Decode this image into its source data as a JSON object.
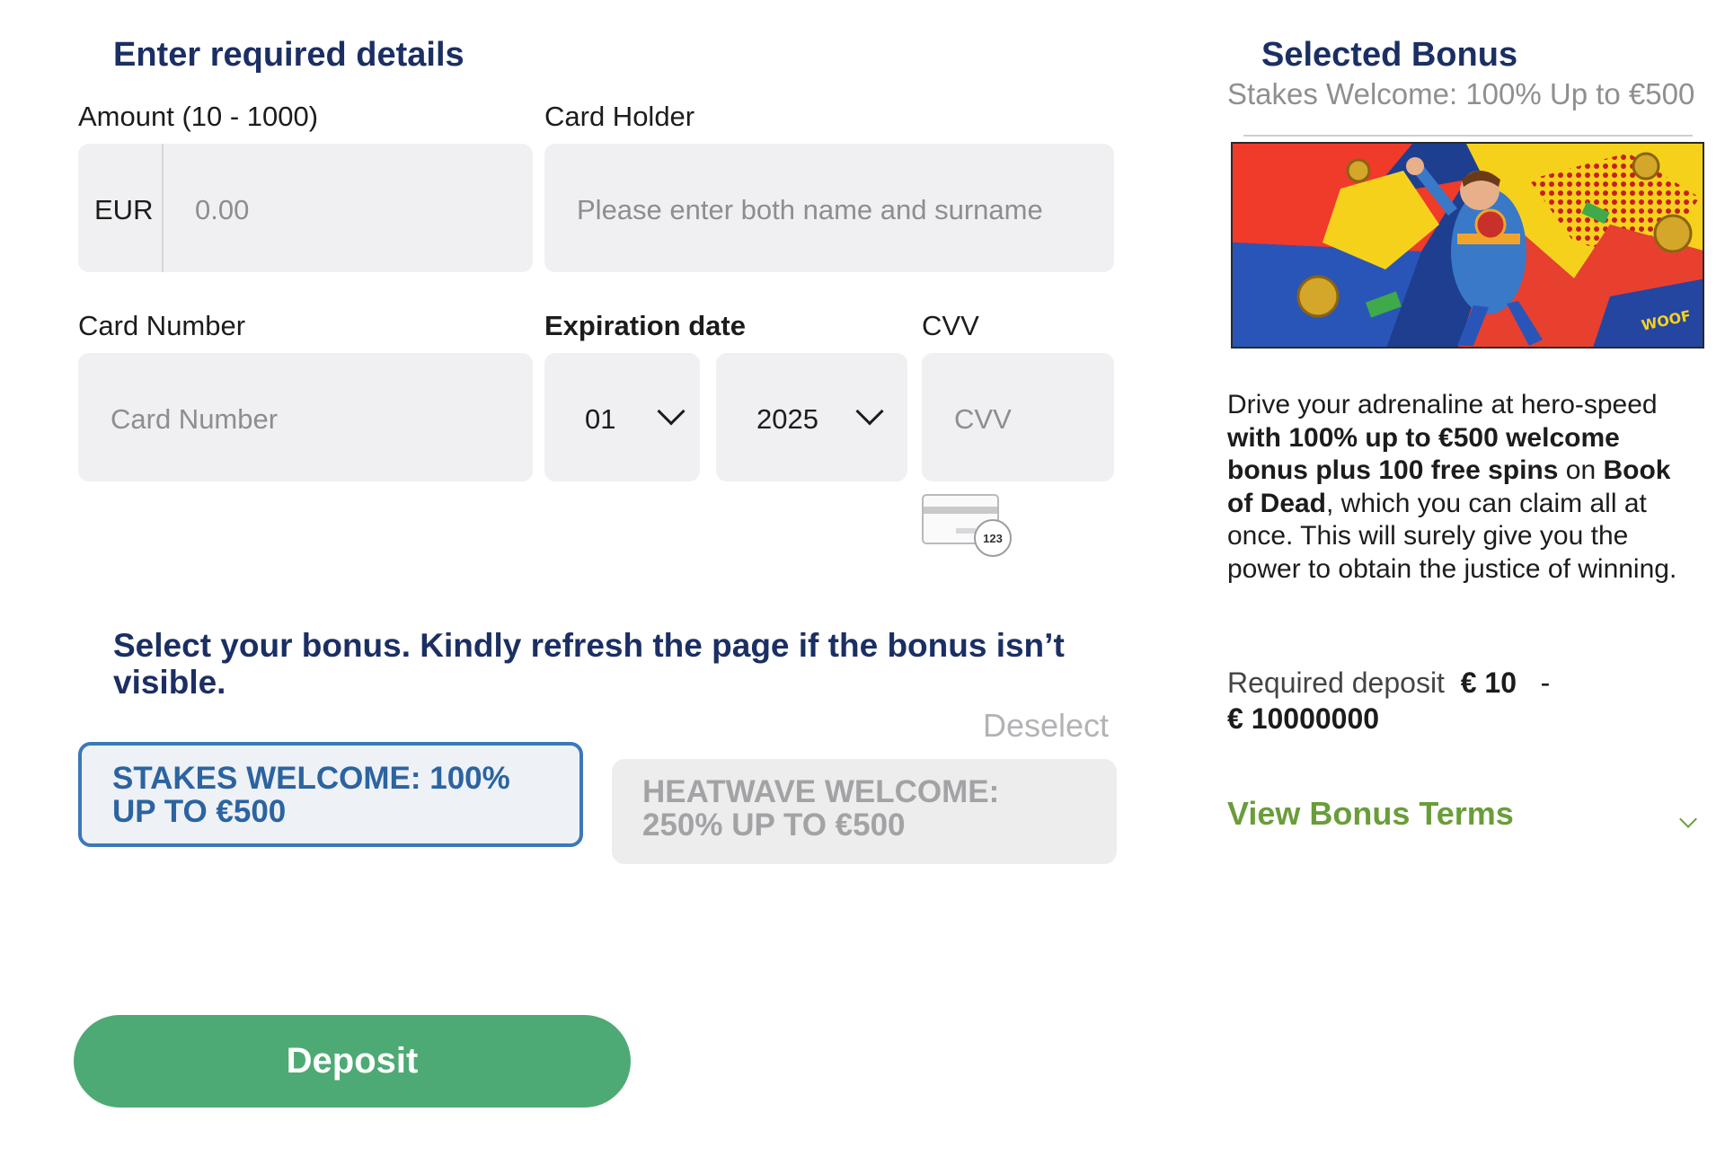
{
  "form": {
    "title": "Enter required details",
    "amount_label": "Amount (10 - 1000)",
    "currency": "EUR",
    "amount_placeholder": "0.00",
    "holder_label": "Card Holder",
    "holder_placeholder": "Please enter both name and surname",
    "card_number_label": "Card Number",
    "card_number_placeholder": "Card Number",
    "expiration_label": "Expiration date",
    "month_value": "01",
    "year_value": "2025",
    "cvv_label": "CVV",
    "cvv_placeholder": "CVV",
    "cvv_hint_text": "123"
  },
  "bonus": {
    "heading": "Select your bonus. Kindly refresh the page if the bonus isn’t visible.",
    "deselect_label": "Deselect",
    "options": [
      {
        "label": "STAKES WELCOME: 100% UP TO €500",
        "selected": true
      },
      {
        "label": "HEATWAVE WELCOME: 250% UP TO €500",
        "selected": false
      }
    ]
  },
  "deposit_label": "Deposit",
  "selected_bonus": {
    "title": "Selected Bonus",
    "name": "Stakes Welcome: 100% Up to €500",
    "image_text": "WOOF",
    "description": {
      "p1": "Drive your adrenaline at hero-speed ",
      "b1": "with 100% up to €500 welcome bonus plus 100 free spins",
      "p2": " on ",
      "b2": "Book of Dead",
      "p3": ", which you can claim all at once. This will surely give you the power to obtain the justice of winning."
    },
    "required_deposit_label": "Required deposit",
    "required_deposit_min": "€ 10",
    "required_deposit_sep": "-",
    "required_deposit_max": "€ 10000000",
    "terms_label": "View Bonus Terms"
  },
  "colors": {
    "heading_blue": "#1b2f63",
    "selected_border": "#3b78b8",
    "deposit_green": "#4daa74",
    "terms_green": "#6a9d3a"
  }
}
